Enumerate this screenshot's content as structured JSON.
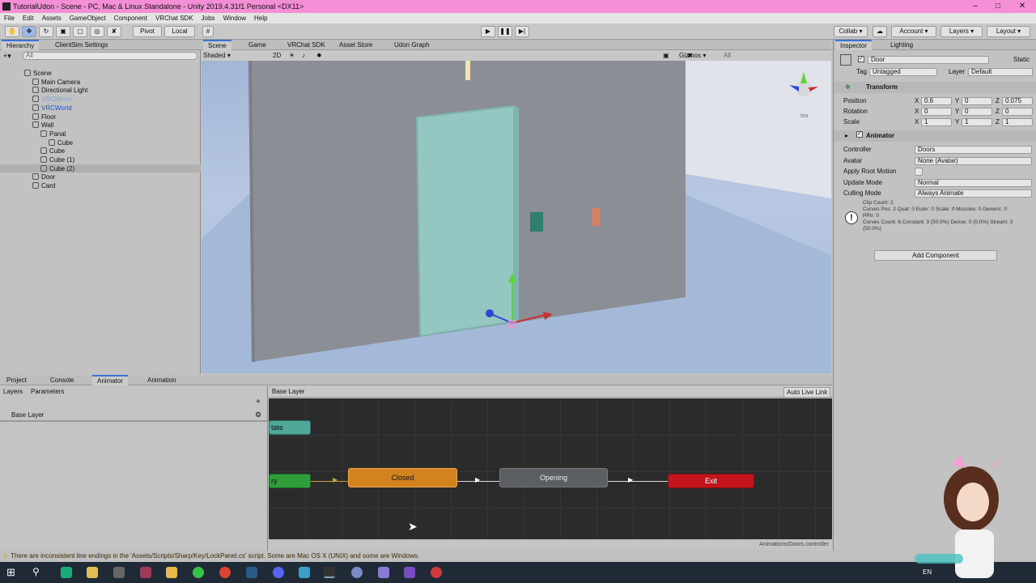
{
  "window": {
    "title": "TutorialUdon - Scene - PC, Mac & Linux Standalone - Unity 2019.4.31f1 Personal <DX11>"
  },
  "menu": [
    "File",
    "Edit",
    "Assets",
    "GameObject",
    "Component",
    "VRChat SDK",
    "Jobs",
    "Window",
    "Help"
  ],
  "toolbar": {
    "pivot": "Pivot",
    "local": "Local",
    "collab": "Collab",
    "account": "Account",
    "layers": "Layers",
    "layout": "Layout"
  },
  "hierarchy": {
    "tabs": [
      "Hierarchy",
      "ClientSim Settings"
    ],
    "search": "All",
    "items": [
      {
        "label": "Scene",
        "indent": 0,
        "tone": "normal"
      },
      {
        "label": "Main Camera",
        "indent": 1,
        "tone": "normal"
      },
      {
        "label": "Directional Light",
        "indent": 1,
        "tone": "normal"
      },
      {
        "label": "VRCMirror",
        "indent": 1,
        "tone": "dim"
      },
      {
        "label": "VRCWorld",
        "indent": 1,
        "tone": "prefab"
      },
      {
        "label": "Floor",
        "indent": 1,
        "tone": "normal"
      },
      {
        "label": "Wall",
        "indent": 1,
        "tone": "normal"
      },
      {
        "label": "Panal",
        "indent": 2,
        "tone": "normal"
      },
      {
        "label": "Cube",
        "indent": 3,
        "tone": "normal"
      },
      {
        "label": "Cube",
        "indent": 2,
        "tone": "normal"
      },
      {
        "label": "Cube (1)",
        "indent": 2,
        "tone": "normal"
      },
      {
        "label": "Cube (2)",
        "indent": 2,
        "tone": "normal"
      },
      {
        "label": "Door",
        "indent": 1,
        "tone": "normal"
      },
      {
        "label": "Card",
        "indent": 1,
        "tone": "normal"
      }
    ]
  },
  "scene": {
    "tabs": [
      "Scene",
      "Game",
      "VRChat SDK",
      "Asset Store",
      "Udon Graph"
    ],
    "shading": "Shaded",
    "mode": "2D",
    "gizmos": "Gizmos",
    "gizmo_search": "All",
    "iso": "Iso"
  },
  "inspector": {
    "tabs": [
      "Inspector",
      "Lighting"
    ],
    "object_name": "Door",
    "static_label": "Static",
    "tag_label": "Tag",
    "tag_value": "Untagged",
    "layer_label": "Layer",
    "layer_value": "Default",
    "transform": {
      "title": "Transform",
      "rows": [
        {
          "label": "Position",
          "x": "0.6",
          "y": "0",
          "z": "0.075"
        },
        {
          "label": "Rotation",
          "x": "0",
          "y": "0",
          "z": "0"
        },
        {
          "label": "Scale",
          "x": "1",
          "y": "1",
          "z": "1"
        }
      ]
    },
    "animator": {
      "title": "Animator",
      "rows": [
        {
          "label": "Controller",
          "value": "Doors"
        },
        {
          "label": "Avatar",
          "value": "None (Avatar)"
        },
        {
          "label": "Apply Root Motion",
          "value": ""
        },
        {
          "label": "Update Mode",
          "value": "Normal"
        },
        {
          "label": "Culling Mode",
          "value": "Always Animate"
        }
      ],
      "info": [
        "Clip Count: 2",
        "Curves Pos: 2 Quat: 0 Euler: 0 Scale: 0 Muscles: 0 Generic: 0",
        "PPtr: 0",
        "Curves Count: 6 Constant: 3 (50.0%) Dense: 0 (0.0%) Stream: 3",
        "(50.0%)"
      ]
    },
    "add_component": "Add Component"
  },
  "bottom": {
    "tabs": [
      "Project",
      "Console",
      "Animator",
      "Animation"
    ],
    "subtabs": [
      "Layers",
      "Parameters"
    ],
    "layer_item": "Base Layer",
    "breadcrumb": "Base Layer",
    "auto_live_link": "Auto Live Link",
    "states": {
      "any": "tate",
      "entry": "ry",
      "closed": "Closed",
      "opening": "Opening",
      "exit": "Exit"
    },
    "path": "Animations/Doors.controller"
  },
  "status": {
    "message": "There are inconsistent line endings in the 'Assets/Scripts/Sharp/Key/LockPanel.cs' script. Some are Mac OS X (UNIX) and some are Windows."
  },
  "taskbar": {
    "lang": "EN"
  },
  "colors": {
    "accent": "#3a72d8",
    "closed_state": "#d2831e",
    "opening_state": "#5b5f63",
    "exit_state": "#c4141c",
    "entry_state": "#2f9e3a",
    "any_state": "#4fa89a",
    "door": "#94c7c2"
  }
}
